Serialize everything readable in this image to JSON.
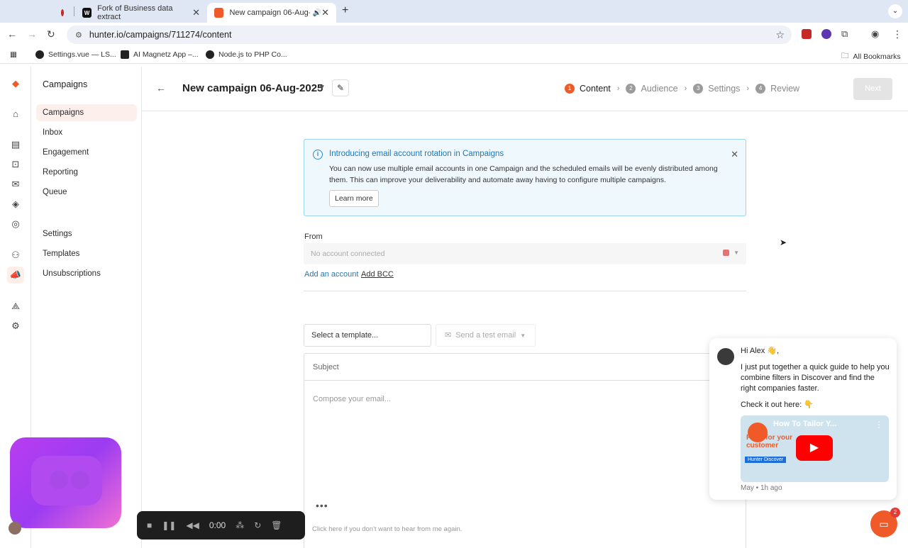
{
  "browser": {
    "tabs": [
      {
        "title": "Fork of Business data extract"
      },
      {
        "title": "New campaign 06-Aug-2025",
        "active": true
      }
    ],
    "url": "hunter.io/campaigns/711274/content",
    "bookmarks": [
      "Settings.vue — LS...",
      "AI Magnetz App –...",
      "Node.js to PHP Co..."
    ],
    "all_bookmarks": "All Bookmarks"
  },
  "sidebar": {
    "title": "Campaigns",
    "items": [
      {
        "label": "Campaigns",
        "active": true
      },
      {
        "label": "Inbox"
      },
      {
        "label": "Engagement"
      },
      {
        "label": "Reporting"
      },
      {
        "label": "Queue"
      },
      {
        "label": "Settings"
      },
      {
        "label": "Templates"
      },
      {
        "label": "Unsubscriptions"
      }
    ]
  },
  "header": {
    "campaign_title": "New campaign 06-Aug-2025",
    "steps": [
      {
        "num": "1",
        "label": "Content",
        "active": true
      },
      {
        "num": "2",
        "label": "Audience"
      },
      {
        "num": "3",
        "label": "Settings"
      },
      {
        "num": "4",
        "label": "Review"
      }
    ],
    "next_label": "Next"
  },
  "notice": {
    "title": "Introducing email account rotation in Campaigns",
    "body": "You can now use multiple email accounts in one Campaign and the scheduled emails will be evenly distributed among them. This can improve your deliverability and automate away having to configure multiple campaigns.",
    "learn_more": "Learn more"
  },
  "from": {
    "label": "From",
    "placeholder": "No account connected",
    "add_account": "Add an account",
    "add_bcc": "Add BCC"
  },
  "editor": {
    "template_placeholder": "Select a template...",
    "test_email": "Send a test email",
    "subject_placeholder": "Subject",
    "compose_placeholder": "Compose your email...",
    "unsubscribe_text": "Click here if you don't want to hear from me again."
  },
  "recorder": {
    "time": "0:00"
  },
  "chat": {
    "greeting": "Hi Alex 👋,",
    "message": "I just put together a quick guide to help you combine filters in Discover and find the right companies faster.",
    "check": "Check it out here: 👇",
    "video_title": "How To Tailor Y...",
    "video_overlay": "Filter for your customer",
    "video_brand": "Hunter Discover",
    "meta": "May • 1h ago",
    "launcher_badge": "2"
  },
  "colors": {
    "accent": "#f05a28",
    "link": "#1f77b4",
    "notice_bg": "#eef8fd"
  }
}
